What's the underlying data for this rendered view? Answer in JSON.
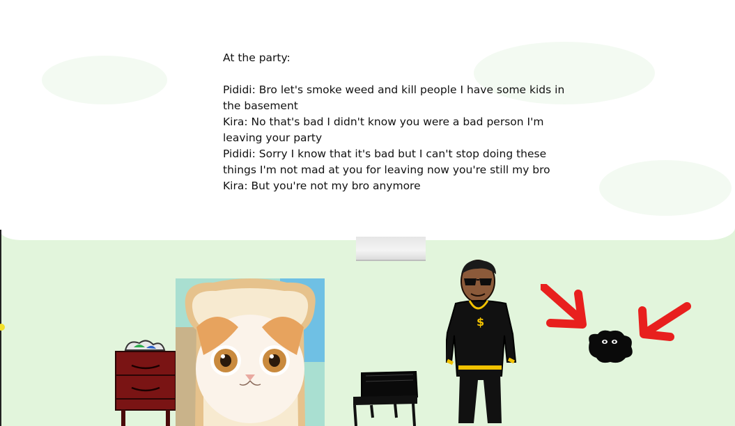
{
  "story": {
    "intro": "At the party:",
    "lines": [
      "Pididi: Bro let's smoke weed and kill people I have some kids in the basement",
      "Kira: No that's bad I didn't know you were a bad person I'm leaving your party",
      "Pididi: Sorry I know that it's bad but I can't stop doing these things I'm not mad at you for leaving now you're still my bro",
      "Kira: But you're not my bro anymore"
    ]
  },
  "colors": {
    "background": "#e2f5dc",
    "paper": "#ffffff",
    "arrow": "#e8201e",
    "drawer": "#7a1414",
    "figure": "#111111",
    "chain": "#f2c200"
  },
  "pictures": [
    "bread-cat-photo",
    "drawer-drawing",
    "piano-drawing",
    "man-drawing",
    "red-arrow-left",
    "red-arrow-right",
    "black-creature"
  ]
}
